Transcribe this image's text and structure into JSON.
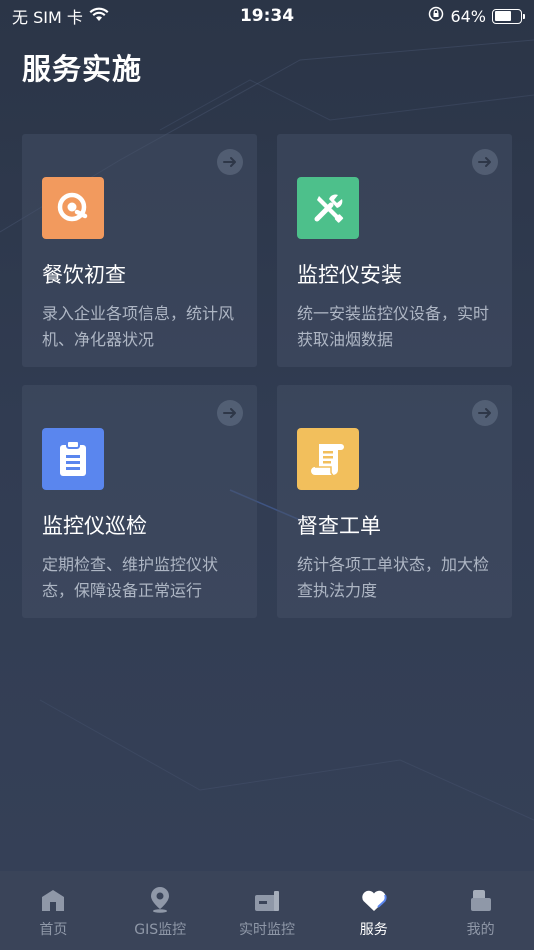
{
  "status_bar": {
    "carrier": "无 SIM 卡",
    "time": "19:34",
    "battery": "64%",
    "battery_level": 0.64
  },
  "page": {
    "title": "服务实施"
  },
  "cards": [
    {
      "title": "餐饮初查",
      "desc": "录入企业各项信息，统计风机、净化器状况",
      "icon": "search-q-icon",
      "color": "#f29a5e"
    },
    {
      "title": "监控仪安装",
      "desc": "统一安装监控仪设备，实时获取油烟数据",
      "icon": "tools-icon",
      "color": "#4dc08b"
    },
    {
      "title": "监控仪巡检",
      "desc": "定期检查、维护监控仪状态，保障设备正常运行",
      "icon": "clipboard-icon",
      "color": "#5a86ee"
    },
    {
      "title": "督查工单",
      "desc": "统计各项工单状态，加大检查执法力度",
      "icon": "scroll-icon",
      "color": "#f2bf5c"
    }
  ],
  "tabs": [
    {
      "label": "首页",
      "icon": "home-icon",
      "active": false
    },
    {
      "label": "GIS监控",
      "icon": "location-pin-icon",
      "active": false
    },
    {
      "label": "实时监控",
      "icon": "monitor-icon",
      "active": false
    },
    {
      "label": "服务",
      "icon": "heart-icon",
      "active": true
    },
    {
      "label": "我的",
      "icon": "profile-icon",
      "active": false
    }
  ]
}
